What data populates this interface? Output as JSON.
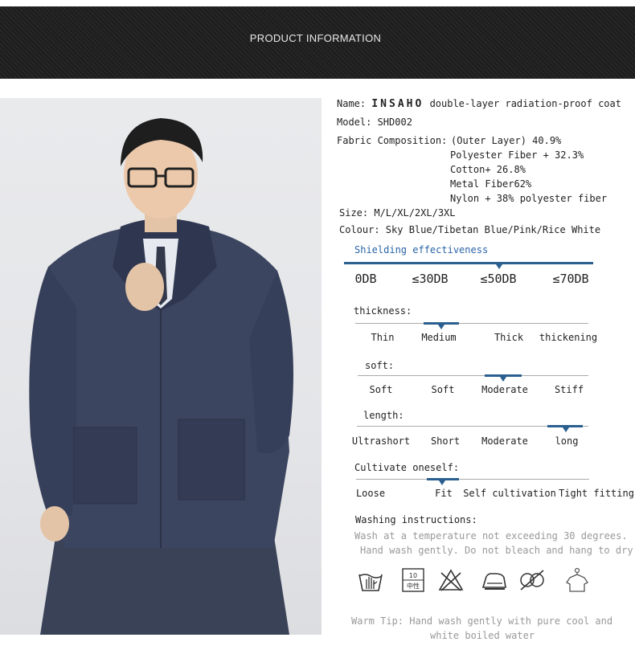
{
  "banner": {
    "title": "PRODUCT INFORMATION"
  },
  "product": {
    "name_label": "Name:",
    "brand": "INSAHO",
    "name_value": "double-layer radiation-proof coat",
    "model": "Model: SHD002",
    "fabric_label": "Fabric Composition:",
    "fabric_lines": [
      "(Outer Layer) 40.9%",
      "Polyester Fiber + 32.3%",
      "Cotton+ 26.8%",
      "Metal Fiber62%",
      "Nylon + 38% polyester fiber"
    ],
    "size": "Size: M/L/XL/2XL/3XL",
    "colour": "Colour: Sky Blue/Tibetan Blue/Pink/Rice White"
  },
  "shielding": {
    "label": "Shielding effectiveness",
    "options": [
      "0DB",
      "≤30DB",
      "≤50DB",
      "≤70DB"
    ],
    "selected": "≤50DB"
  },
  "thickness": {
    "label": "thickness:",
    "options": [
      "Thin",
      "Medium",
      "Thick",
      "thickening"
    ],
    "selected": "Medium"
  },
  "soft": {
    "label": "soft:",
    "options": [
      "Soft",
      "Soft",
      "Moderate",
      "Stiff"
    ],
    "selected": "Moderate"
  },
  "length": {
    "label": "length:",
    "options": [
      "Ultrashort",
      "Short",
      "Moderate",
      "long"
    ],
    "selected": "long"
  },
  "cultivate": {
    "label": "Cultivate oneself:",
    "options": [
      "Loose",
      "Fit",
      "Self cultivation",
      "Tight fitting"
    ],
    "selected": "Fit"
  },
  "washing": {
    "label": "Washing instructions:",
    "line1": "Wash at a temperature not exceeding 30 degrees.",
    "line2": "Hand wash gently. Do not bleach and hang to dry.",
    "icons": [
      "hand-wash-icon",
      "medium-temperature-icon",
      "no-bleach-icon",
      "low-iron-icon",
      "no-dry-clean-icon",
      "hang-dry-icon"
    ],
    "medium_temp_number": "10",
    "medium_temp_text": "中性"
  },
  "tip": {
    "line1": "Warm Tip: Hand wash gently with pure cool and",
    "line2": "white boiled water"
  },
  "colors": {
    "accent": "#2a5f8f",
    "link_blue": "#2a64a6",
    "banner": "#222222"
  }
}
